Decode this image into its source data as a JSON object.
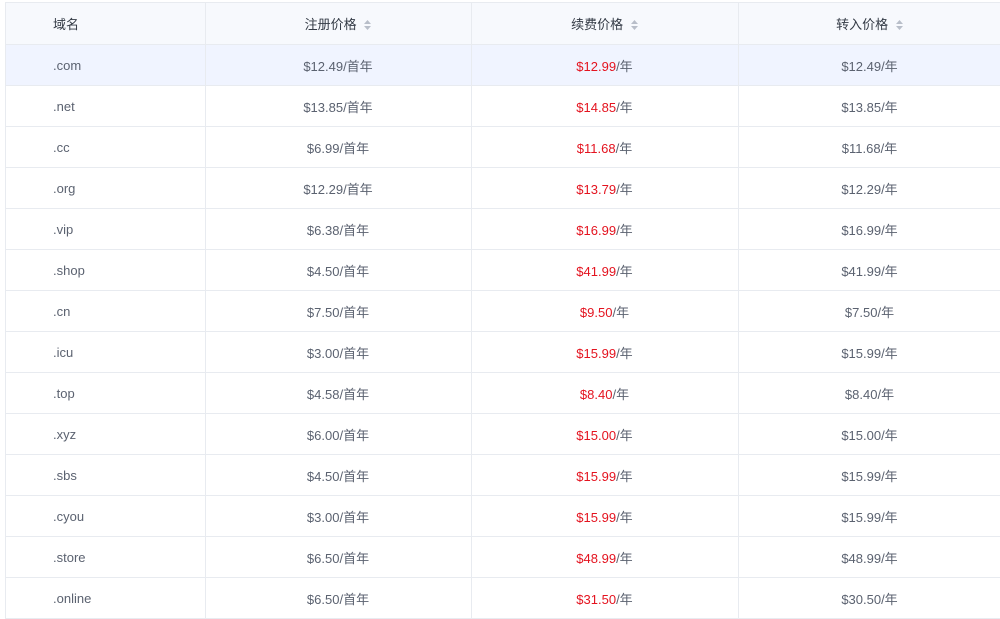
{
  "table": {
    "headers": {
      "domain": "域名",
      "register": "注册价格",
      "renew": "续费价格",
      "transfer": "转入价格"
    },
    "rows": [
      {
        "domain": ".com",
        "register": "$12.49/首年",
        "renew_price": "$12.99",
        "renew_unit": "/年",
        "transfer": "$12.49/年"
      },
      {
        "domain": ".net",
        "register": "$13.85/首年",
        "renew_price": "$14.85",
        "renew_unit": "/年",
        "transfer": "$13.85/年"
      },
      {
        "domain": ".cc",
        "register": "$6.99/首年",
        "renew_price": "$11.68",
        "renew_unit": "/年",
        "transfer": "$11.68/年"
      },
      {
        "domain": ".org",
        "register": "$12.29/首年",
        "renew_price": "$13.79",
        "renew_unit": "/年",
        "transfer": "$12.29/年"
      },
      {
        "domain": ".vip",
        "register": "$6.38/首年",
        "renew_price": "$16.99",
        "renew_unit": "/年",
        "transfer": "$16.99/年"
      },
      {
        "domain": ".shop",
        "register": "$4.50/首年",
        "renew_price": "$41.99",
        "renew_unit": "/年",
        "transfer": "$41.99/年"
      },
      {
        "domain": ".cn",
        "register": "$7.50/首年",
        "renew_price": "$9.50",
        "renew_unit": "/年",
        "transfer": "$7.50/年"
      },
      {
        "domain": ".icu",
        "register": "$3.00/首年",
        "renew_price": "$15.99",
        "renew_unit": "/年",
        "transfer": "$15.99/年"
      },
      {
        "domain": ".top",
        "register": "$4.58/首年",
        "renew_price": "$8.40",
        "renew_unit": "/年",
        "transfer": "$8.40/年"
      },
      {
        "domain": ".xyz",
        "register": "$6.00/首年",
        "renew_price": "$15.00",
        "renew_unit": "/年",
        "transfer": "$15.00/年"
      },
      {
        "domain": ".sbs",
        "register": "$4.50/首年",
        "renew_price": "$15.99",
        "renew_unit": "/年",
        "transfer": "$15.99/年"
      },
      {
        "domain": ".cyou",
        "register": "$3.00/首年",
        "renew_price": "$15.99",
        "renew_unit": "/年",
        "transfer": "$15.99/年"
      },
      {
        "domain": ".store",
        "register": "$6.50/首年",
        "renew_price": "$48.99",
        "renew_unit": "/年",
        "transfer": "$48.99/年"
      },
      {
        "domain": ".online",
        "register": "$6.50/首年",
        "renew_price": "$31.50",
        "renew_unit": "/年",
        "transfer": "$30.50/年"
      }
    ]
  },
  "colors": {
    "header_bg": "#f7f9fd",
    "highlight_row_bg": "#f0f4ff",
    "renew_price": "#e4131f",
    "border": "#e8ebf0"
  },
  "icons": {
    "sort": "sort-icon"
  }
}
